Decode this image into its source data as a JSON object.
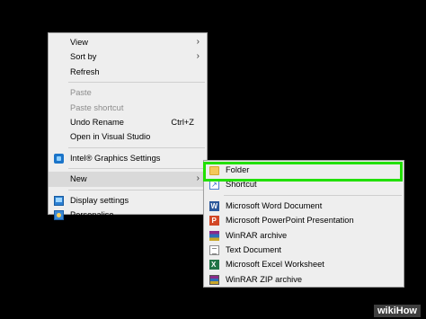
{
  "context_menu": {
    "items": [
      {
        "label": "View",
        "submenu": true
      },
      {
        "label": "Sort by",
        "submenu": true
      },
      {
        "label": "Refresh"
      },
      {
        "label": "Paste",
        "disabled": true
      },
      {
        "label": "Paste shortcut",
        "disabled": true
      },
      {
        "label": "Undo Rename",
        "shortcut": "Ctrl+Z"
      },
      {
        "label": "Open in Visual Studio"
      },
      {
        "label": "Intel® Graphics Settings",
        "icon": "intel-icon"
      },
      {
        "label": "New",
        "submenu": true
      },
      {
        "label": "Display settings",
        "icon": "display-settings-icon"
      },
      {
        "label": "Personalise",
        "icon": "personalise-icon"
      }
    ]
  },
  "new_submenu": {
    "items": [
      {
        "label": "Folder",
        "icon": "folder-icon",
        "highlighted": true
      },
      {
        "label": "Shortcut",
        "icon": "shortcut-icon"
      },
      {
        "label": "Microsoft Word Document",
        "icon": "word-icon"
      },
      {
        "label": "Microsoft PowerPoint Presentation",
        "icon": "powerpoint-icon"
      },
      {
        "label": "WinRAR archive",
        "icon": "winrar-icon"
      },
      {
        "label": "Text Document",
        "icon": "text-document-icon"
      },
      {
        "label": "Microsoft Excel Worksheet",
        "icon": "excel-icon"
      },
      {
        "label": "WinRAR ZIP archive",
        "icon": "winrar-zip-icon"
      }
    ]
  },
  "watermark": "wikiHow",
  "colors": {
    "desktop_background": "#000000",
    "menu_background": "#eeeeee",
    "highlight_border": "#22e000",
    "disabled_text": "#8c8c8c"
  }
}
